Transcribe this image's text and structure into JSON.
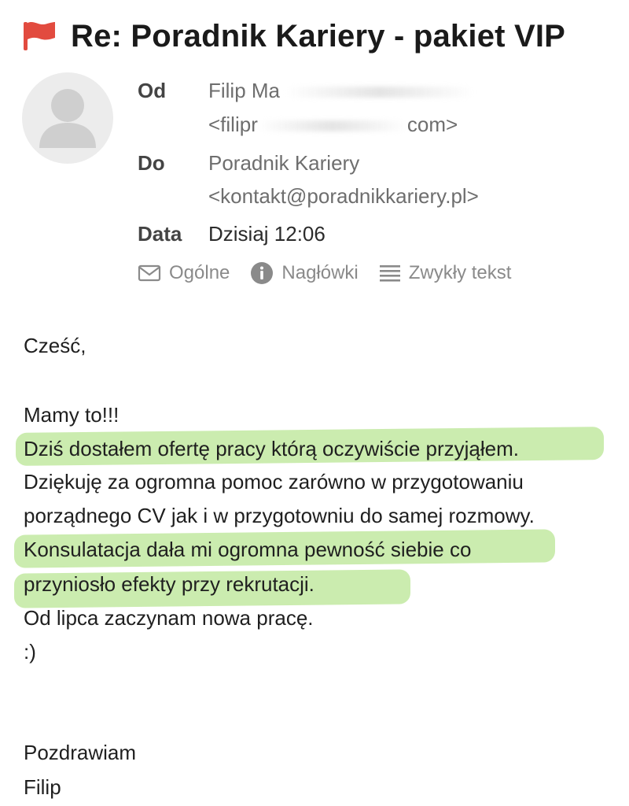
{
  "email": {
    "subject": "Re: Poradnik Kariery - pakiet VIP",
    "flag_icon": "flag-icon",
    "flag_color": "#e24b3f",
    "headers": {
      "from_label": "Od",
      "from_name": "Filip Ma",
      "from_email_start": "<filipr",
      "from_email_end": "com>",
      "to_label": "Do",
      "to_name": "Poradnik Kariery",
      "to_email": "<kontakt@poradnikkariery.pl>",
      "date_label": "Data",
      "date_value": "Dzisiaj 12:06"
    },
    "tabs": [
      {
        "label": "Ogólne",
        "icon": "envelope-icon"
      },
      {
        "label": "Nagłówki",
        "icon": "info-icon"
      },
      {
        "label": "Zwykły tekst",
        "icon": "lines-icon"
      }
    ],
    "body": {
      "greeting": "Cześć,",
      "line1": "Mamy to!!!",
      "line2": "Dziś dostałem ofertę pracy którą oczywiście przyjąłem.",
      "line3": "Dziękuję za ogromna pomoc zarówno w przygotowaniu",
      "line4": "porządnego CV jak i w przygotowniu do samej rozmowy.",
      "line5": "Konsulatacja dała mi ogromna pewność siebie co",
      "line6": "przyniosło efekty przy rekrutacji.",
      "line7": "Od lipca zaczynam nowa pracę.",
      "line8": ":)",
      "signoff": "Pozdrawiam",
      "signature": "Filip"
    },
    "highlight_color": "#c5eaa6"
  }
}
